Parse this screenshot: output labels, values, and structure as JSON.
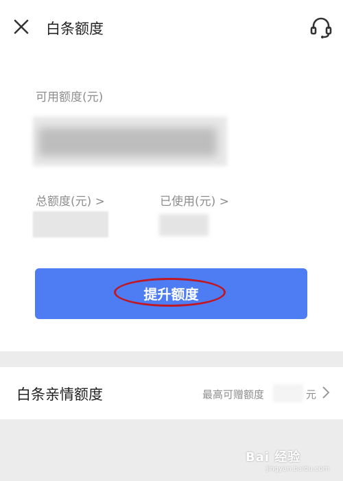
{
  "header": {
    "title": "白条额度",
    "close_icon": "close-icon",
    "support_icon": "headset-icon"
  },
  "credit": {
    "available_label": "可用额度(元)",
    "total_label": "总额度(元) >",
    "used_label": "已使用(元) >"
  },
  "raise_button": {
    "label": "提升额度",
    "highlight_color": "#c11722",
    "button_color": "#4d7cf3"
  },
  "family": {
    "title": "白条亲情额度",
    "subtitle": "最高可赠额度",
    "unit": "元",
    "chevron_icon": "chevron-right-icon"
  },
  "watermark": {
    "text": "Bai 经验",
    "url": "jingyan.baidu.com"
  }
}
